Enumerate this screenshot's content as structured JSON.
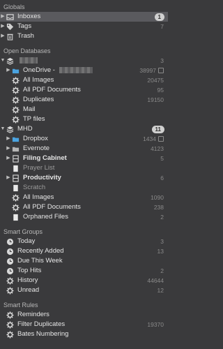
{
  "globals": {
    "header": "Globals",
    "items": [
      {
        "label": "Inboxes",
        "badge": "1"
      },
      {
        "label": "Tags",
        "count": "7"
      },
      {
        "label": "Trash",
        "count": ""
      }
    ]
  },
  "open_databases": {
    "header": "Open Databases",
    "db1": {
      "badge": "3",
      "onedrive": {
        "label": "OneDrive - ",
        "count": "38997"
      },
      "items": [
        {
          "label": "All Images",
          "count": "20475"
        },
        {
          "label": "All PDF Documents",
          "count": "95"
        },
        {
          "label": "Duplicates",
          "count": "19150"
        },
        {
          "label": "Mail",
          "count": ""
        },
        {
          "label": "TP files",
          "count": ""
        }
      ]
    },
    "db2": {
      "name": "MHD",
      "badge": "11",
      "items": [
        {
          "label": "Dropbox",
          "count": "1434"
        },
        {
          "label": "Evernote",
          "count": "4123"
        },
        {
          "label": "Filing Cabinet",
          "count": "5"
        },
        {
          "label": "Prayer List",
          "count": ""
        },
        {
          "label": "Productivity",
          "count": "6"
        },
        {
          "label": "Scratch",
          "count": ""
        },
        {
          "label": "All Images",
          "count": "1090"
        },
        {
          "label": "All PDF Documents",
          "count": "238"
        },
        {
          "label": "Orphaned Files",
          "count": "2"
        }
      ]
    }
  },
  "smart_groups": {
    "header": "Smart Groups",
    "items": [
      {
        "label": "Today",
        "count": "3"
      },
      {
        "label": "Recently Added",
        "count": "13"
      },
      {
        "label": "Due This Week",
        "count": ""
      },
      {
        "label": "Top Hits",
        "count": "2"
      },
      {
        "label": "History",
        "count": "44644"
      },
      {
        "label": "Unread",
        "count": "12"
      }
    ]
  },
  "smart_rules": {
    "header": "Smart Rules",
    "items": [
      {
        "label": "Reminders",
        "count": ""
      },
      {
        "label": "Filter Duplicates",
        "count": "19370"
      },
      {
        "label": "Bates Numbering",
        "count": ""
      }
    ]
  }
}
